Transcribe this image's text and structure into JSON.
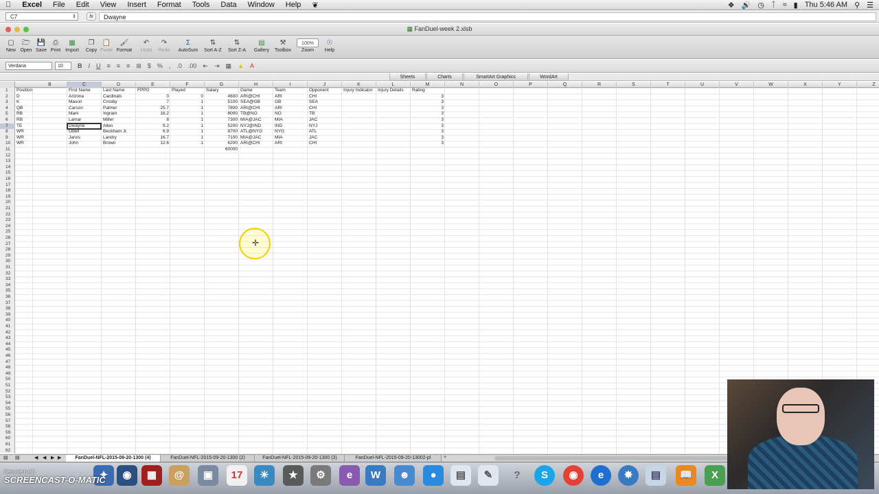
{
  "menubar": {
    "apple": "",
    "items": [
      "Excel",
      "File",
      "Edit",
      "View",
      "Insert",
      "Format",
      "Tools",
      "Data",
      "Window",
      "Help"
    ],
    "clock": "Thu 5:46 AM"
  },
  "formula_bar": {
    "name_box": "C7",
    "fx_label": "fx",
    "content": "Dwayne"
  },
  "window": {
    "title": "FanDuel-week 2.xlsb"
  },
  "toolbar": {
    "new": "New",
    "open": "Open",
    "save": "Save",
    "print": "Print",
    "import": "Import",
    "copy": "Copy",
    "paste": "Paste",
    "format": "Format",
    "undo": "Undo",
    "redo": "Redo",
    "autosum": "AutoSum",
    "sort_az": "Sort A-Z",
    "sort_za": "Sort Z-A",
    "gallery": "Gallery",
    "toolbox": "Toolbox",
    "zoom_label": "Zoom",
    "zoom_value": "100%",
    "help": "Help"
  },
  "format_bar": {
    "font": "Verdana",
    "size": "10"
  },
  "ribbon_tabs": [
    "Sheets",
    "Charts",
    "SmartArt Graphics",
    "WordArt"
  ],
  "columns": [
    "B",
    "C",
    "D",
    "E",
    "F",
    "G",
    "H",
    "I",
    "J",
    "K",
    "L",
    "M",
    "N",
    "O",
    "P",
    "Q",
    "R",
    "S",
    "T",
    "U",
    "V",
    "W",
    "X",
    "Y",
    "Z"
  ],
  "selected_column": "C",
  "selected_row": 7,
  "row_count": 62,
  "sheet_rows": [
    {
      "row": 1,
      "A": "Position",
      "C": "First Name",
      "D": "Last Name",
      "E": "FPPG",
      "F": "Played",
      "G": "Salary",
      "H": "Game",
      "I": "Team",
      "J": "Opponent",
      "K": "Injury Indicator",
      "L": "Injury Details",
      "M": "Rating"
    },
    {
      "row": 2,
      "A": "D",
      "C": "Arizona",
      "D": "Cardinals",
      "E": "0",
      "F": "0",
      "G": "4600",
      "H": "ARI@CHI",
      "I": "ARI",
      "J": "CHI",
      "M": "3"
    },
    {
      "row": 3,
      "A": "K",
      "C": "Mason",
      "D": "Crosby",
      "E": "7",
      "F": "1",
      "G": "5100",
      "H": "SEA@GB",
      "I": "GB",
      "J": "SEA",
      "M": "3"
    },
    {
      "row": 4,
      "A": "QB",
      "C": "Carson",
      "D": "Palmer",
      "E": "25.7",
      "F": "1",
      "G": "7800",
      "H": "ARI@CHI",
      "I": "ARI",
      "J": "CHI",
      "M": "3"
    },
    {
      "row": 5,
      "A": "RB",
      "C": "Mark",
      "D": "Ingram",
      "E": "16.2",
      "F": "1",
      "G": "8000",
      "H": "TB@NO",
      "I": "NO",
      "J": "TB",
      "M": "3"
    },
    {
      "row": 6,
      "A": "RB",
      "C": "Lamar",
      "D": "Miller",
      "E": "8",
      "F": "1",
      "G": "7300",
      "H": "MIA@JAC",
      "I": "MIA",
      "J": "JAC",
      "M": "3"
    },
    {
      "row": 7,
      "A": "TE",
      "C": "Dwayne",
      "D": "Allen",
      "E": "9.2",
      "F": "1",
      "G": "5200",
      "H": "NYJ@IND",
      "I": "IND",
      "J": "NYJ",
      "M": "3"
    },
    {
      "row": 8,
      "A": "WR",
      "C": "Odell",
      "D": "Beckham Jr.",
      "E": "6.9",
      "F": "1",
      "G": "8700",
      "H": "ATL@NYG",
      "I": "NYG",
      "J": "ATL",
      "M": "3"
    },
    {
      "row": 9,
      "A": "WR",
      "C": "Jarvis",
      "D": "Landry",
      "E": "16.7",
      "F": "1",
      "G": "7100",
      "H": "MIA@JAC",
      "I": "MIA",
      "J": "JAC",
      "M": "3"
    },
    {
      "row": 10,
      "A": "WR",
      "C": "John",
      "D": "Brown",
      "E": "12.6",
      "F": "1",
      "G": "6200",
      "H": "ARI@CHI",
      "I": "ARI",
      "J": "CHI",
      "M": "3"
    },
    {
      "row": 11,
      "G": "60000"
    }
  ],
  "sheet_tabs": [
    "FanDuel-NFL-2015-09-20-1300 (4)",
    "FanDuel-NFL-2015-09-20-1300 (2)",
    "FanDuel-NFL-2015-09-20-1300 (3)",
    "FanDuel-NFL-2015-09-20-13002-pl"
  ],
  "watermark": {
    "line1": "Recorded with",
    "line2": "SCREENCAST-O-MATIC"
  }
}
